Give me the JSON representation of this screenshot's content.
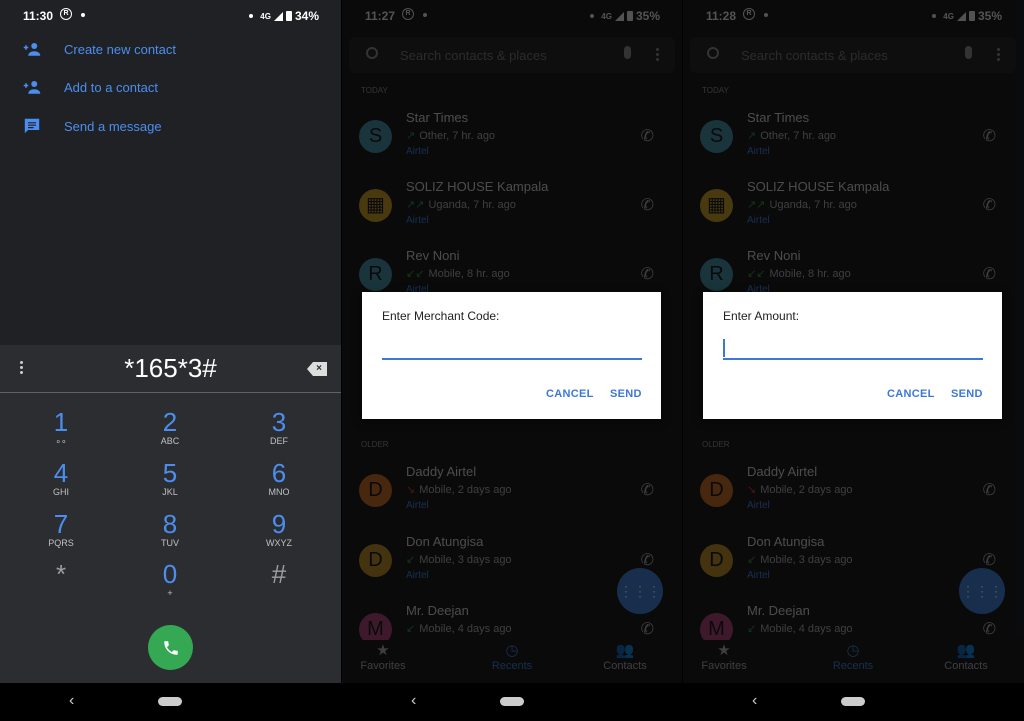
{
  "panel1": {
    "status": {
      "time": "11:30",
      "network": "4G",
      "battery": "34%"
    },
    "menu": [
      {
        "label": "Create new contact",
        "icon": "person-add-icon"
      },
      {
        "label": "Add to a contact",
        "icon": "person-add-icon"
      },
      {
        "label": "Send a message",
        "icon": "message-icon"
      }
    ],
    "dialed_number": "*165*3#",
    "keys": [
      {
        "digit": "1",
        "sub": "voicemail-icon"
      },
      {
        "digit": "2",
        "sub": "ABC"
      },
      {
        "digit": "3",
        "sub": "DEF"
      },
      {
        "digit": "4",
        "sub": "GHI"
      },
      {
        "digit": "5",
        "sub": "JKL"
      },
      {
        "digit": "6",
        "sub": "MNO"
      },
      {
        "digit": "7",
        "sub": "PQRS"
      },
      {
        "digit": "8",
        "sub": "TUV"
      },
      {
        "digit": "9",
        "sub": "WXYZ"
      },
      {
        "digit": "*",
        "sub": ""
      },
      {
        "digit": "0",
        "sub": "+"
      },
      {
        "digit": "#",
        "sub": ""
      }
    ],
    "call_color": "#34a853"
  },
  "recents": {
    "search_placeholder": "Search contacts & places",
    "today_label": "TODAY",
    "older_label": "OLDER",
    "today": [
      {
        "initial": "S",
        "name": "Star Times",
        "detail": "Other, 7 hr. ago",
        "tag": "Airtel",
        "color": "#4fa3b8",
        "dir": "↗"
      },
      {
        "initial": "▦",
        "name": "SOLIZ HOUSE Kampala",
        "detail": "Uganda, 7 hr. ago",
        "tag": "Airtel",
        "color": "#e0b030",
        "dir": "↗↗"
      },
      {
        "initial": "R",
        "name": "Rev Noni",
        "detail": "Mobile, 8 hr. ago",
        "tag": "Airtel",
        "color": "#4fa3b8",
        "dir": "↙↙"
      }
    ],
    "older": [
      {
        "initial": "D",
        "name": "Daddy Airtel",
        "detail": "Mobile, 2 days ago",
        "tag": "Airtel",
        "color": "#e07a30",
        "dir": "↘",
        "missed": true
      },
      {
        "initial": "D",
        "name": "Don Atungisa",
        "detail": "Mobile, 3 days ago",
        "tag": "Airtel",
        "color": "#d0a030",
        "dir": "↙"
      },
      {
        "initial": "M",
        "name": "Mr. Deejan",
        "detail": "Mobile, 4 days ago",
        "tag": "",
        "color": "#c0508a",
        "dir": "↙"
      }
    ],
    "tabs": [
      {
        "label": "Favorites",
        "icon": "star-icon"
      },
      {
        "label": "Recents",
        "icon": "clock-icon",
        "active": true
      },
      {
        "label": "Contacts",
        "icon": "people-icon"
      }
    ]
  },
  "panel2": {
    "status": {
      "time": "11:27",
      "network": "4G",
      "battery": "35%"
    },
    "dialog": {
      "title": "Enter Merchant Code:",
      "value": "",
      "cancel": "CANCEL",
      "send": "SEND"
    }
  },
  "panel3": {
    "status": {
      "time": "11:28",
      "network": "4G",
      "battery": "35%"
    },
    "dialog": {
      "title": "Enter Amount:",
      "value": "",
      "cancel": "CANCEL",
      "send": "SEND"
    }
  }
}
